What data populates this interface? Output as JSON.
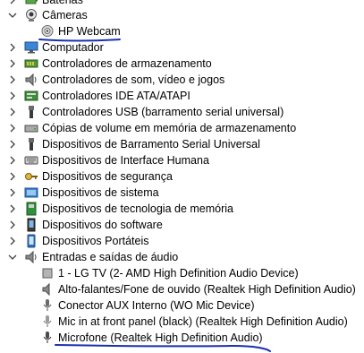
{
  "tree": {
    "top_partial_label": "Baterias",
    "cameras": {
      "label": "Câmeras",
      "children": [
        "HP Webcam"
      ]
    },
    "categories": [
      "Computador",
      "Controladores de armazenamento",
      "Controladores de som, vídeo e jogos",
      "Controladores IDE ATA/ATAPI",
      "Controladores USB (barramento serial universal)",
      "Cópias de volume em memória de armazenamento",
      "Dispositivos de Barramento Serial Universal",
      "Dispositivos de Interface Humana",
      "Dispositivos de segurança",
      "Dispositivos de sistema",
      "Dispositivos de tecnologia de memória",
      "Dispositivos do software",
      "Dispositivos Portáteis"
    ],
    "audio": {
      "label": "Entradas e saídas de áudio",
      "children": [
        "1 - LG TV (2- AMD High Definition Audio Device)",
        "Alto-falantes/Fone de ouvido (Realtek High Definition Audio)",
        "Conector AUX Interno (WO Mic Device)",
        "Mic in at front panel (black) (Realtek High Definition Audio)",
        "Microfone (Realtek High Definition Audio)"
      ]
    }
  },
  "colors": {
    "annotation_ink": "#1a2fb0",
    "chevron": "#404040",
    "icon_gray": "#6b6b6b",
    "icon_blue": "#2a6fc4",
    "icon_green": "#2f8f3a"
  }
}
